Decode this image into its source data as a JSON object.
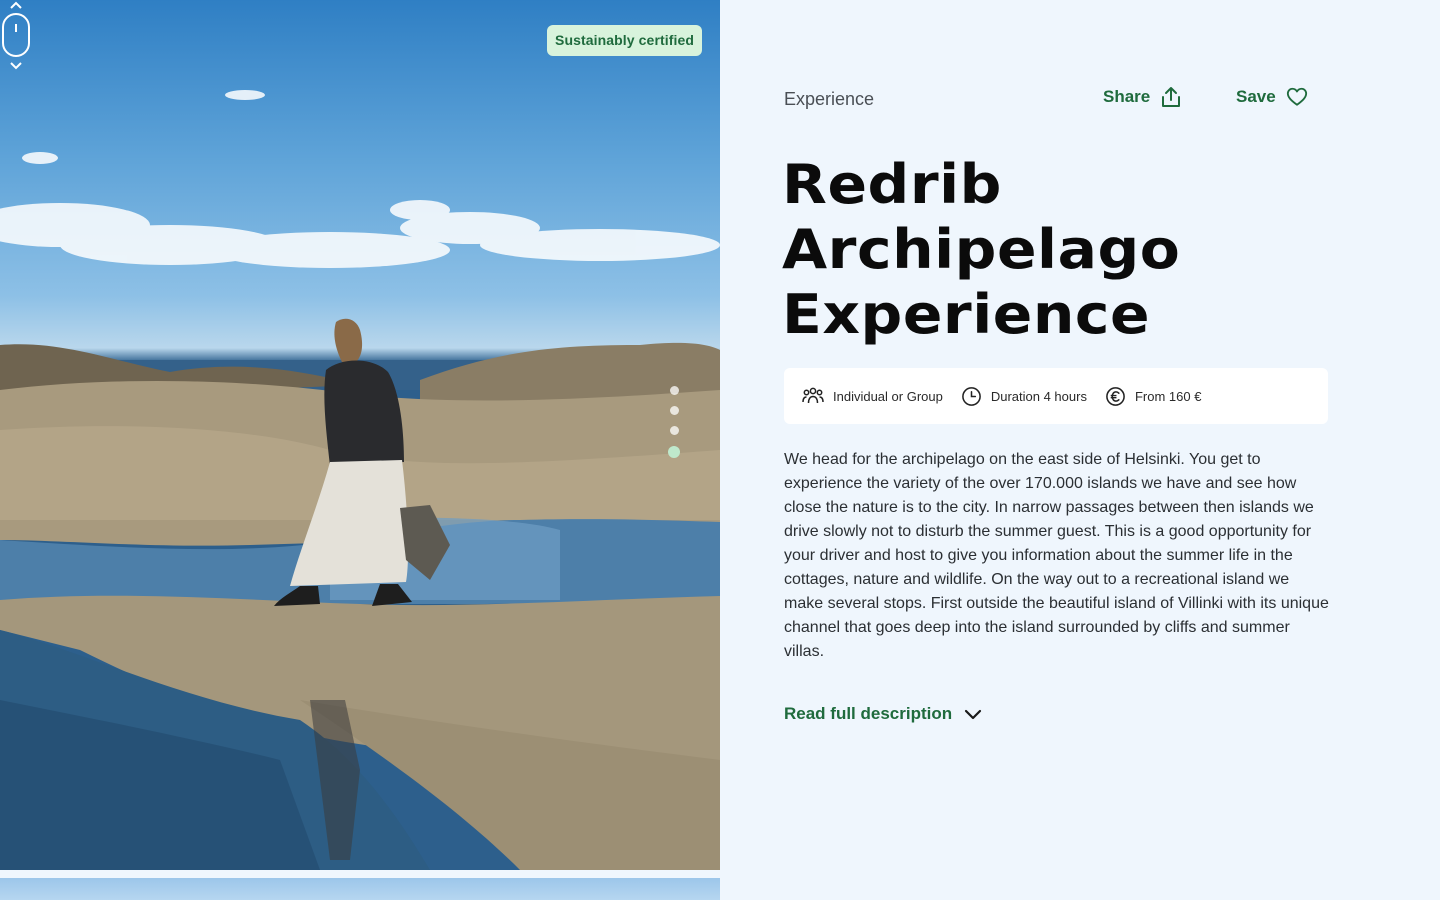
{
  "media": {
    "badge": "Sustainably certified",
    "carousel": {
      "slide_count": 4,
      "active_index": 3
    }
  },
  "content": {
    "category": "Experience",
    "share_label": "Share",
    "save_label": "Save",
    "title_lines": [
      "Redrib",
      "Archipelago",
      "Experience"
    ],
    "facts": [
      {
        "icon": "group-icon",
        "text": "Individual or Group"
      },
      {
        "icon": "clock-icon",
        "text": "Duration 4 hours"
      },
      {
        "icon": "euro-icon",
        "text": "From 160 €"
      }
    ],
    "description": "We head for the archipelago on the east side of Helsinki. You get to experience the variety of the over 170.000 islands we have and see how close the nature is to the city. In narrow passages between then islands we drive slowly not to disturb the summer guest. This is a good opportunity for your driver and host to give you information about the summer life in the cottages, nature and wildlife. On the way out to a recreational island we make several stops. First outside the beautiful island of Villinki with its unique channel that goes deep into the island surrounded by cliffs and summer villas.",
    "read_more_label": "Read full description"
  },
  "colors": {
    "accent_green": "#1f6b3d",
    "badge_bg": "#d8f3dc",
    "page_bg": "#eff6fd"
  }
}
